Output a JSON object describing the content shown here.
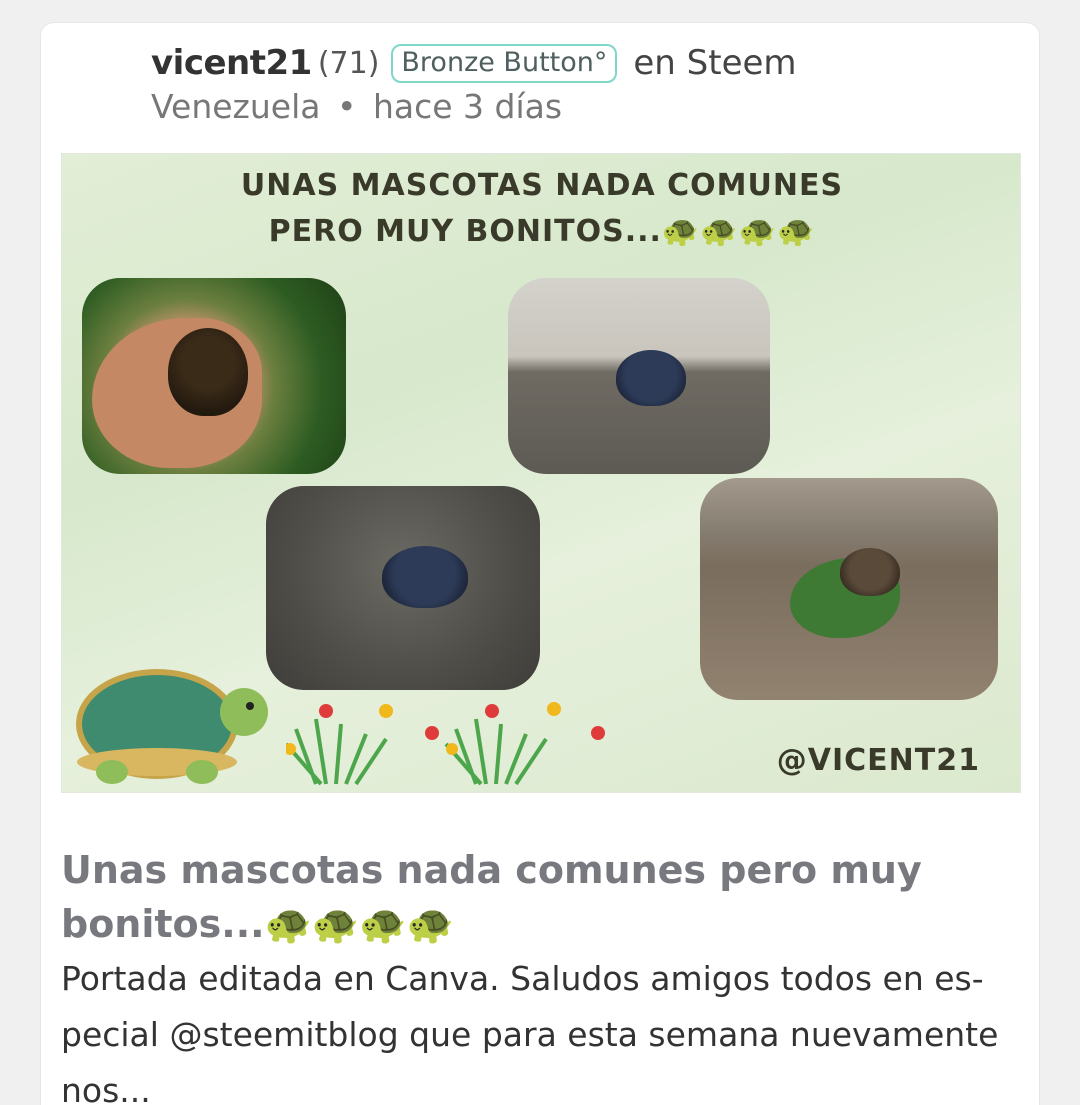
{
  "post": {
    "author": "vicent21",
    "reputation": "(71)",
    "badge": "Bronze Button°",
    "community": "en Steem",
    "location": "Venezuela",
    "separator": "•",
    "time": "hace 3 días",
    "cover": {
      "title_line1": "UNAS MASCOTAS NADA COMUNES",
      "title_line2": "PERO MUY BONITOS...🐢🐢🐢🐢",
      "handle": "@VICENT21"
    },
    "title": "Unas mascotas nada comunes pero muy bonitos...🐢🐢🐢🐢",
    "excerpt": "Portada editada en Canva. Saludos amigos todos en es-pecial @steemitblog que para esta semana nuevamente nos..."
  },
  "colors": {
    "badge_border": "#7fd7c5",
    "title_gray": "#77797e",
    "cover_bg": "#dbe9ce"
  }
}
